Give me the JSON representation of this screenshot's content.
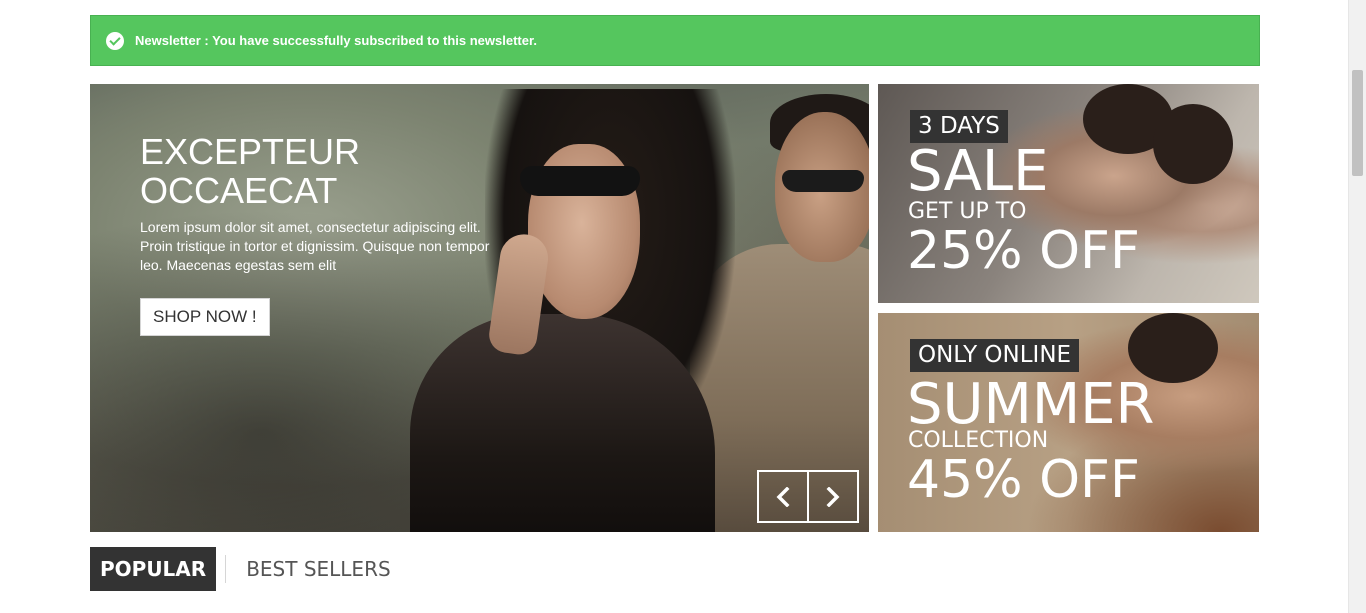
{
  "alert": {
    "message": "Newsletter : You have successfully subscribed to this newsletter.",
    "color": "#55c65e",
    "icon": "check-circle-icon"
  },
  "slider": {
    "title": "EXCEPTEUR OCCAECAT",
    "description": "Lorem ipsum dolor sit amet, consectetur adipiscing elit. Proin tristique in tortor et dignissim. Quisque non tempor leo. Maecenas egestas sem elit",
    "button_label": "SHOP NOW !",
    "prev_icon": "chevron-left-icon",
    "next_icon": "chevron-right-icon"
  },
  "banners": [
    {
      "tag": "3 DAYS",
      "big": "SALE",
      "sub": "GET UP TO",
      "offer": "25% OFF"
    },
    {
      "tag": "ONLY ONLINE",
      "big": "SUMMER",
      "sub": "COLLECTION",
      "offer": "45% OFF"
    }
  ],
  "tabs": [
    {
      "label": "POPULAR",
      "active": true
    },
    {
      "label": "BEST SELLERS",
      "active": false
    }
  ],
  "colors": {
    "tab_active_bg": "#333333",
    "tag_bg": "#333333"
  }
}
